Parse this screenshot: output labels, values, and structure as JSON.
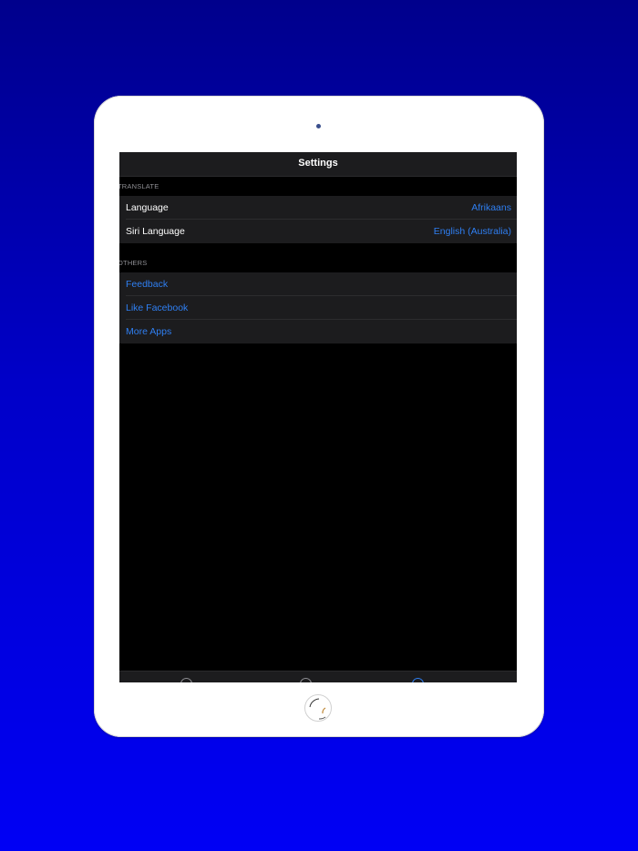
{
  "nav": {
    "title": "Settings"
  },
  "sections": {
    "translate": {
      "header": "TRANSLATE",
      "rows": [
        {
          "label": "Language",
          "value": "Afrikaans"
        },
        {
          "label": "Siri Language",
          "value": "English (Australia)"
        }
      ]
    },
    "others": {
      "header": "OTHERS",
      "rows": [
        {
          "label": "Feedback"
        },
        {
          "label": "Like Facebook"
        },
        {
          "label": "More Apps"
        }
      ]
    }
  },
  "tabbar": {
    "tabs": [
      {
        "icon": "translate-tab-icon",
        "selected": false
      },
      {
        "icon": "history-tab-icon",
        "selected": false
      },
      {
        "icon": "settings-tab-icon",
        "selected": true
      }
    ]
  },
  "colors": {
    "background_top": "#00008c",
    "background_bottom": "#0000f5",
    "accent": "#2f7ff2",
    "screen_bg": "#000000",
    "row_bg": "#1c1c1e",
    "section_header": "#8e8e93"
  }
}
